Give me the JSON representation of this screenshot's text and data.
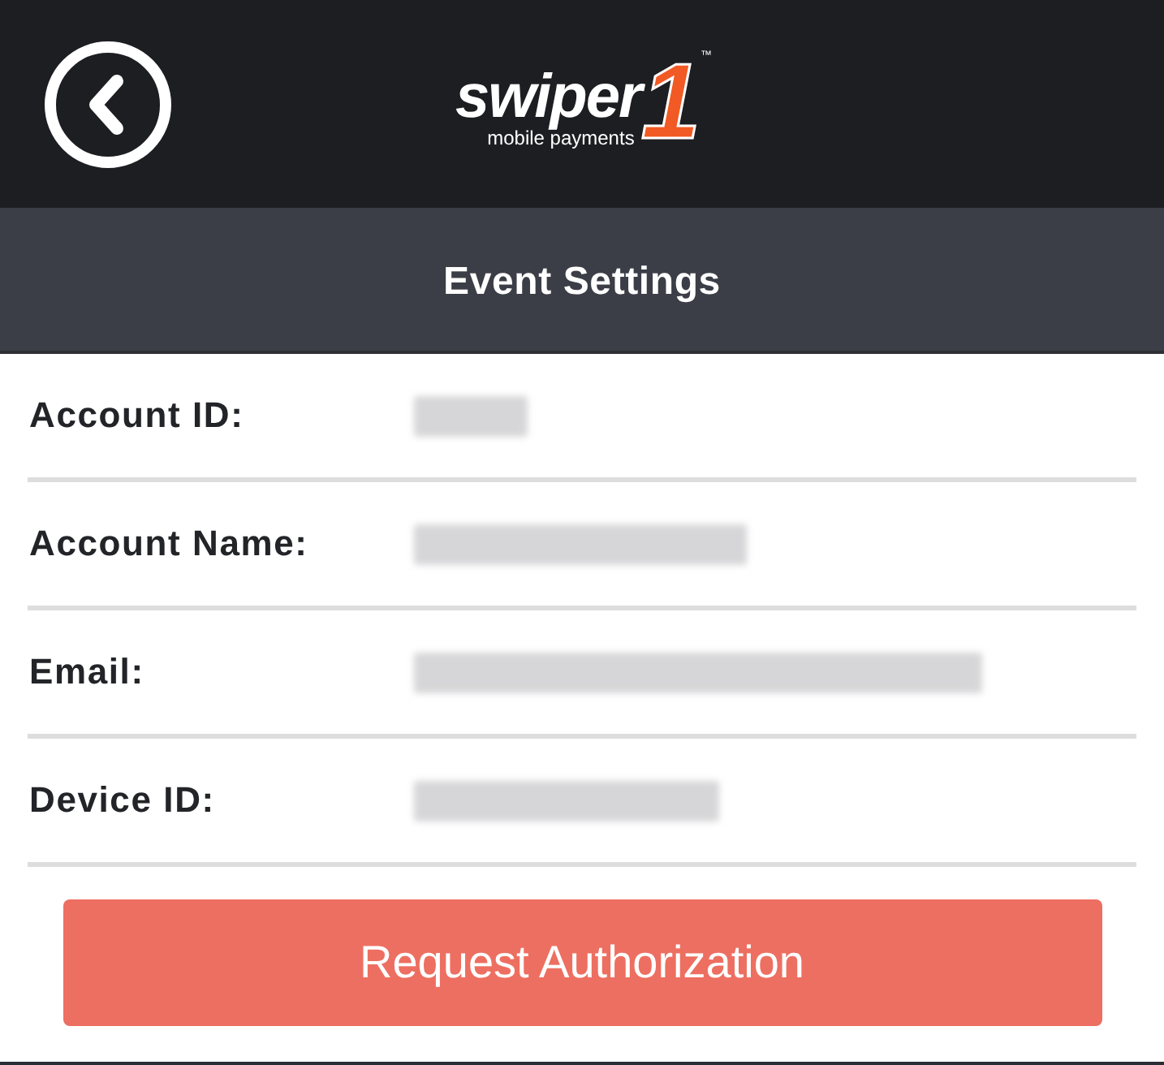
{
  "header": {
    "logo": {
      "wordmark": "swiper",
      "numeral": "1",
      "trademark": "™",
      "tagline": "mobile payments"
    }
  },
  "title_bar": {
    "title": "Event Settings"
  },
  "fields": [
    {
      "label": "Account ID:",
      "redacted": true
    },
    {
      "label": "Account Name:",
      "redacted": true
    },
    {
      "label": "Email:",
      "redacted": true
    },
    {
      "label": "Device ID:",
      "redacted": true
    }
  ],
  "action_button": {
    "label": "Request Authorization"
  }
}
